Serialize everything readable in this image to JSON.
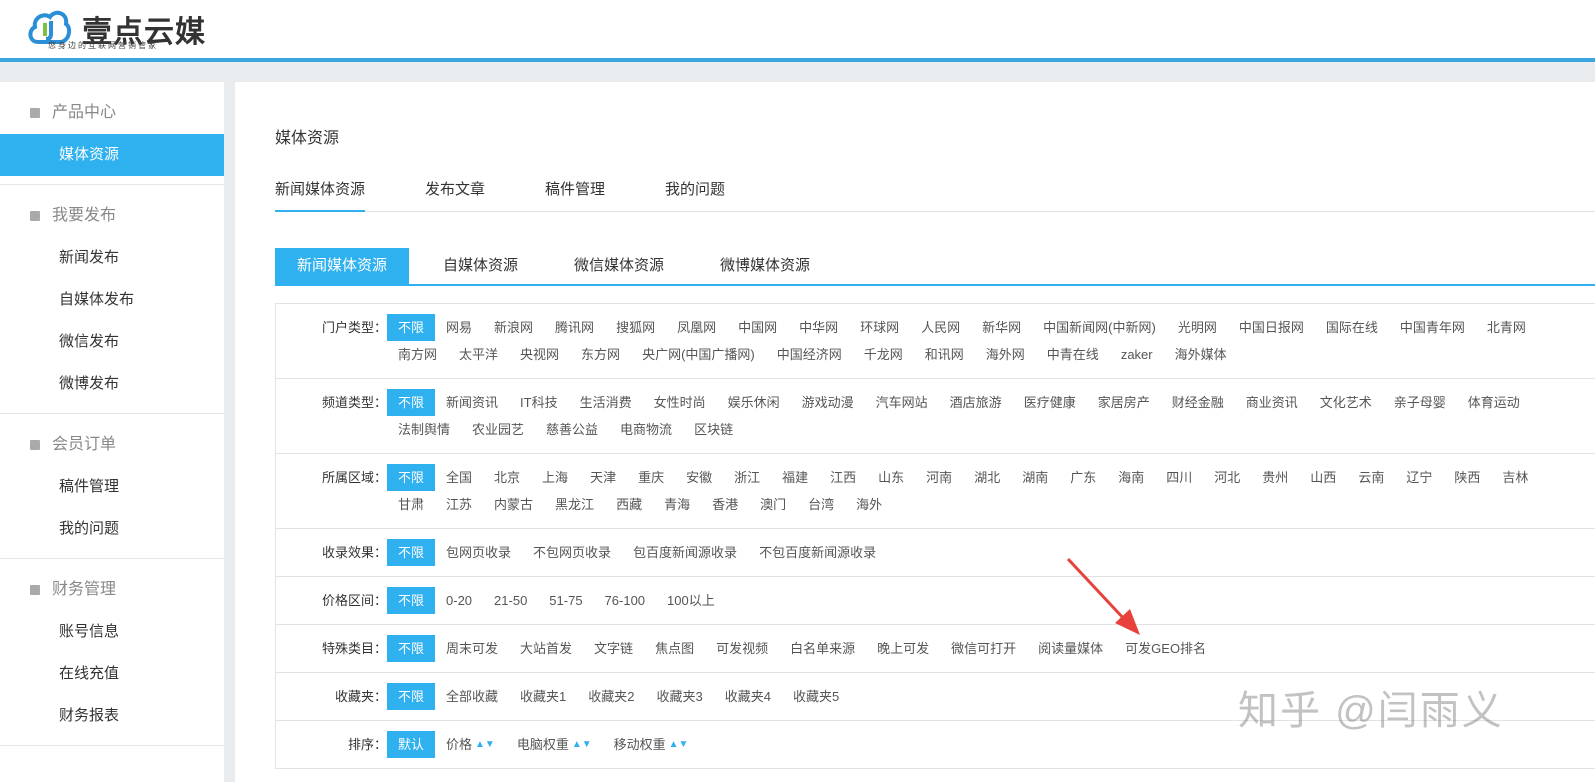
{
  "brand": {
    "name": "壹点云媒",
    "tagline": "您身边的互联网营销管家"
  },
  "sidebar": [
    {
      "title": "产品中心",
      "icon": "grid-icon",
      "items": [
        {
          "label": "媒体资源",
          "active": true
        }
      ]
    },
    {
      "title": "我要发布",
      "icon": "folder-icon",
      "items": [
        {
          "label": "新闻发布"
        },
        {
          "label": "自媒体发布"
        },
        {
          "label": "微信发布"
        },
        {
          "label": "微博发布"
        }
      ]
    },
    {
      "title": "会员订单",
      "icon": "cart-icon",
      "items": [
        {
          "label": "稿件管理"
        },
        {
          "label": "我的问题"
        }
      ]
    },
    {
      "title": "财务管理",
      "icon": "finance-icon",
      "items": [
        {
          "label": "账号信息"
        },
        {
          "label": "在线充值"
        },
        {
          "label": "财务报表"
        }
      ]
    }
  ],
  "main": {
    "title": "媒体资源",
    "tabs": [
      "新闻媒体资源",
      "发布文章",
      "稿件管理",
      "我的问题"
    ],
    "subtabs": [
      "新闻媒体资源",
      "自媒体资源",
      "微信媒体资源",
      "微博媒体资源"
    ],
    "filters": [
      {
        "label": "门户类型：",
        "items": [
          "不限",
          "网易",
          "新浪网",
          "腾讯网",
          "搜狐网",
          "凤凰网",
          "中国网",
          "中华网",
          "环球网",
          "人民网",
          "新华网",
          "中国新闻网(中新网)",
          "光明网",
          "中国日报网",
          "国际在线",
          "中国青年网",
          "北青网",
          "南方网",
          "太平洋",
          "央视网",
          "东方网",
          "央广网(中国广播网)",
          "中国经济网",
          "千龙网",
          "和讯网",
          "海外网",
          "中青在线",
          "zaker",
          "海外媒体"
        ]
      },
      {
        "label": "频道类型：",
        "items": [
          "不限",
          "新闻资讯",
          "IT科技",
          "生活消费",
          "女性时尚",
          "娱乐休闲",
          "游戏动漫",
          "汽车网站",
          "酒店旅游",
          "医疗健康",
          "家居房产",
          "财经金融",
          "商业资讯",
          "文化艺术",
          "亲子母婴",
          "体育运动",
          "法制舆情",
          "农业园艺",
          "慈善公益",
          "电商物流",
          "区块链"
        ]
      },
      {
        "label": "所属区域：",
        "items": [
          "不限",
          "全国",
          "北京",
          "上海",
          "天津",
          "重庆",
          "安徽",
          "浙江",
          "福建",
          "江西",
          "山东",
          "河南",
          "湖北",
          "湖南",
          "广东",
          "海南",
          "四川",
          "河北",
          "贵州",
          "山西",
          "云南",
          "辽宁",
          "陕西",
          "吉林",
          "甘肃",
          "江苏",
          "内蒙古",
          "黑龙江",
          "西藏",
          "青海",
          "香港",
          "澳门",
          "台湾",
          "海外"
        ]
      },
      {
        "label": "收录效果：",
        "items": [
          "不限",
          "包网页收录",
          "不包网页收录",
          "包百度新闻源收录",
          "不包百度新闻源收录"
        ]
      },
      {
        "label": "价格区间：",
        "items": [
          "不限",
          "0-20",
          "21-50",
          "51-75",
          "76-100",
          "100以上"
        ]
      },
      {
        "label": "特殊类目：",
        "items": [
          "不限",
          "周末可发",
          "大站首发",
          "文字链",
          "焦点图",
          "可发视频",
          "白名单来源",
          "晚上可发",
          "微信可打开",
          "阅读量媒体",
          "可发GEO排名"
        ]
      },
      {
        "label": "收藏夹：",
        "items": [
          "不限",
          "全部收藏",
          "收藏夹1",
          "收藏夹2",
          "收藏夹3",
          "收藏夹4",
          "收藏夹5"
        ]
      },
      {
        "label": "排序：",
        "items": [
          "默认",
          "价格",
          "电脑权重",
          "移动权重"
        ],
        "sortable": true
      }
    ]
  },
  "watermark": "知乎 @闫雨义",
  "colors": {
    "accent": "#2fb0ef",
    "arrow": "#e8413b"
  }
}
